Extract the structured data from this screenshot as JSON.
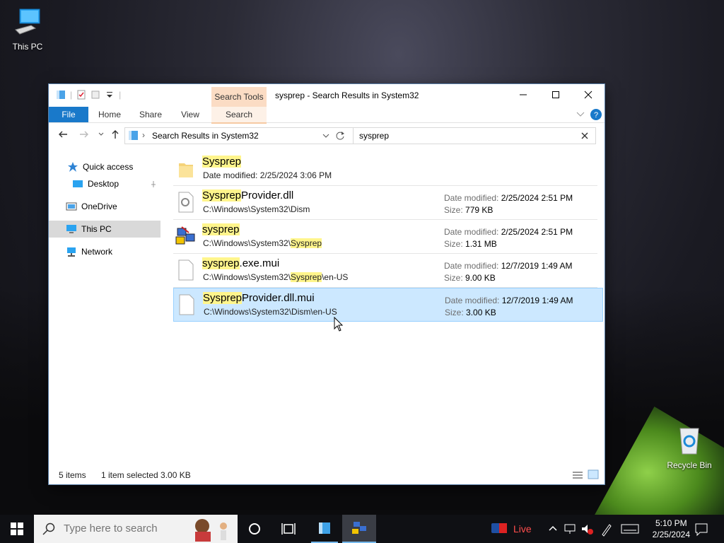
{
  "desktop": {
    "icons": [
      {
        "label": "This PC"
      },
      {
        "label": "Recycle Bin"
      }
    ]
  },
  "window": {
    "title": "sysprep - Search Results in System32",
    "context_tab": "Search Tools",
    "ribbon_tabs": [
      "File",
      "Home",
      "Share",
      "View",
      "Search"
    ],
    "address": "Search Results in System32",
    "search_value": "sysprep",
    "nav": [
      {
        "label": "Quick access"
      },
      {
        "label": "Desktop"
      },
      {
        "label": "OneDrive"
      },
      {
        "label": "This PC"
      },
      {
        "label": "Network"
      }
    ],
    "results": [
      {
        "hl": "Sysprep",
        "rest": "",
        "sub": "Date modified: 2/25/2024 3:06 PM",
        "sub_hl": "",
        "sub_rest": "",
        "date_label": "",
        "date": "",
        "size_label": "",
        "size": ""
      },
      {
        "hl": "Sysprep",
        "rest": "Provider.dll",
        "sub": "C:\\Windows\\System32\\Dism",
        "sub_hl": "",
        "sub_rest": "",
        "date_label": "Date modified:",
        "date": "2/25/2024 2:51 PM",
        "size_label": "Size:",
        "size": "779 KB"
      },
      {
        "hl": "sysprep",
        "rest": "",
        "sub": "C:\\Windows\\System32\\",
        "sub_hl": "Sysprep",
        "sub_rest": "",
        "date_label": "Date modified:",
        "date": "2/25/2024 2:51 PM",
        "size_label": "Size:",
        "size": "1.31 MB"
      },
      {
        "hl": "sysprep",
        "rest": ".exe.mui",
        "sub": "C:\\Windows\\System32\\",
        "sub_hl": "Sysprep",
        "sub_rest": "\\en-US",
        "date_label": "Date modified:",
        "date": "12/7/2019 1:49 AM",
        "size_label": "Size:",
        "size": "9.00 KB"
      },
      {
        "hl": "Sysprep",
        "rest": "Provider.dll.mui",
        "sub": "C:\\Windows\\System32\\Dism\\en-US",
        "sub_hl": "",
        "sub_rest": "",
        "date_label": "Date modified:",
        "date": "12/7/2019 1:49 AM",
        "size_label": "Size:",
        "size": "3.00 KB"
      }
    ],
    "status": {
      "count": "5 items",
      "selected": "1 item selected  3.00 KB"
    }
  },
  "taskbar": {
    "search_placeholder": "Type here to search",
    "live_label": "Live",
    "time": "5:10 PM",
    "date": "2/25/2024"
  },
  "colors": {
    "accent": "#1979ca",
    "selection": "#cce8ff",
    "highlight": "#fff58c",
    "context_tab": "#fbdcc4"
  }
}
